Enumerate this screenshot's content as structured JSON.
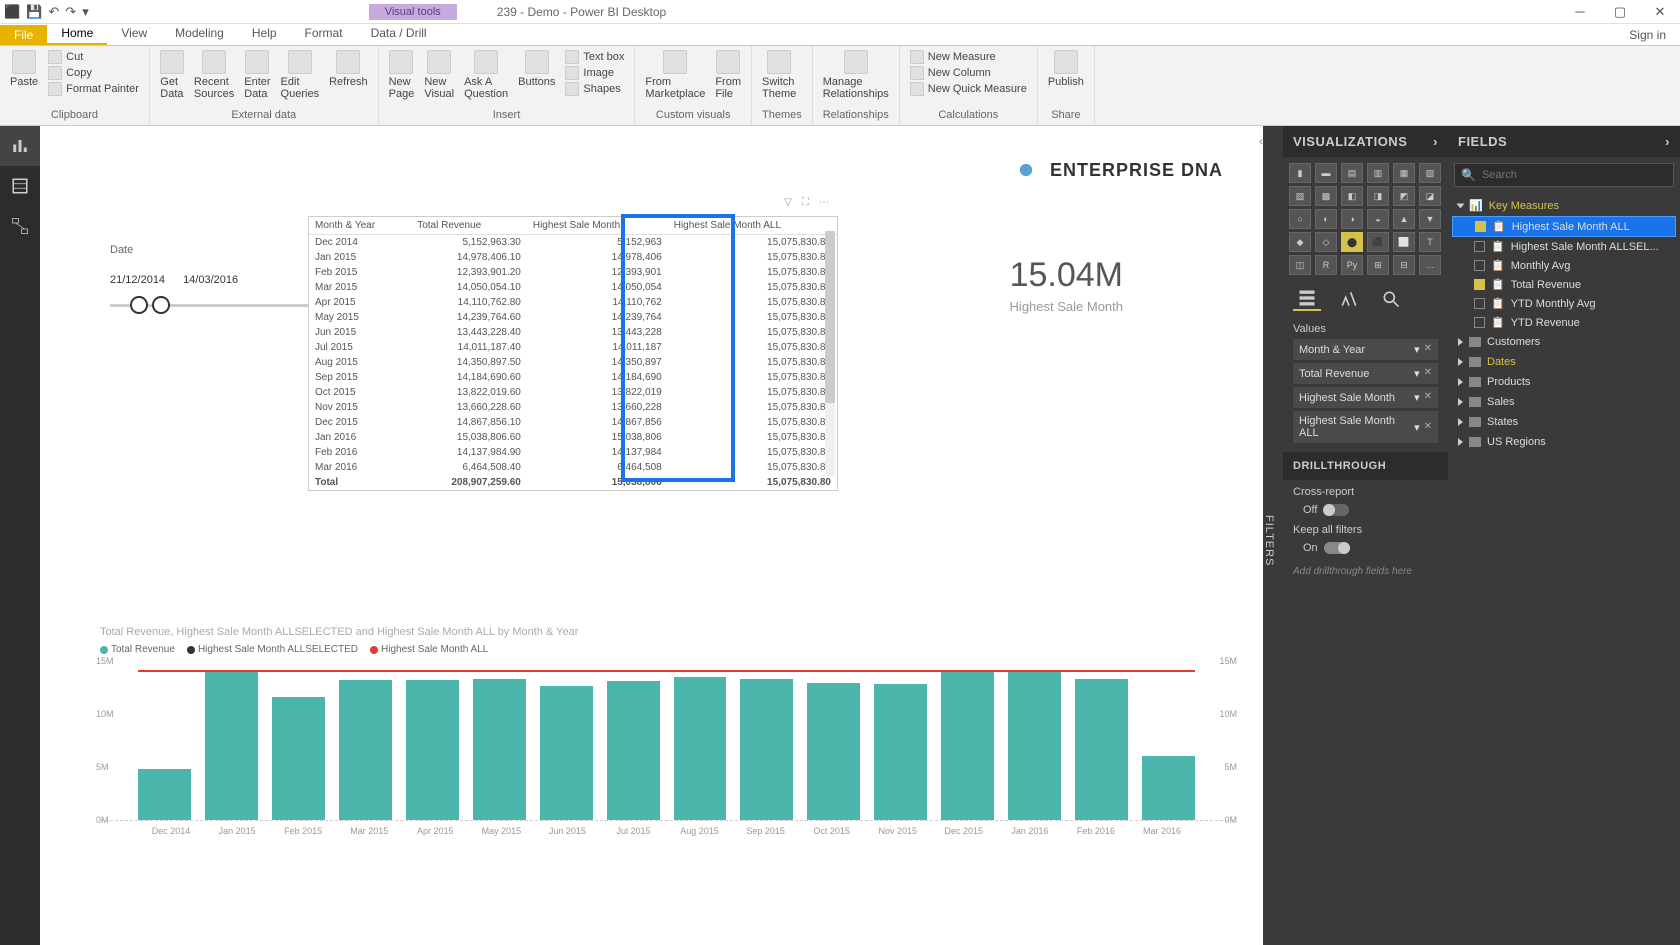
{
  "titlebar": {
    "doc": "239 - Demo - Power BI Desktop",
    "visual_tools": "Visual tools"
  },
  "tabs": {
    "file": "File",
    "items": [
      "Home",
      "View",
      "Modeling",
      "Help",
      "Format",
      "Data / Drill"
    ],
    "active": "Home",
    "signin": "Sign in"
  },
  "ribbon": {
    "clipboard": {
      "paste": "Paste",
      "cut": "Cut",
      "copy": "Copy",
      "fp": "Format Painter",
      "label": "Clipboard"
    },
    "external": {
      "getdata": "Get\nData",
      "recent": "Recent\nSources",
      "enter": "Enter\nData",
      "edit": "Edit\nQueries",
      "refresh": "Refresh",
      "label": "External data"
    },
    "insert": {
      "newpage": "New\nPage",
      "newvisual": "New\nVisual",
      "ask": "Ask A\nQuestion",
      "buttons": "Buttons",
      "textbox": "Text box",
      "image": "Image",
      "shapes": "Shapes",
      "label": "Insert"
    },
    "custom": {
      "market": "From\nMarketplace",
      "file": "From\nFile",
      "label": "Custom visuals"
    },
    "themes": {
      "switch": "Switch\nTheme",
      "label": "Themes"
    },
    "rel": {
      "manage": "Manage\nRelationships",
      "label": "Relationships"
    },
    "calc": {
      "nm": "New Measure",
      "nc": "New Column",
      "nqm": "New Quick Measure",
      "label": "Calculations"
    },
    "share": {
      "publish": "Publish",
      "label": "Share"
    }
  },
  "slicer": {
    "label": "Date",
    "from": "21/12/2014",
    "to": "14/03/2016"
  },
  "table": {
    "headers": [
      "Month & Year",
      "Total Revenue",
      "Highest Sale Month",
      "Highest Sale Month ALL"
    ],
    "rows": [
      [
        "Dec 2014",
        "5,152,963.30",
        "5,152,963",
        "15,075,830.80"
      ],
      [
        "Jan 2015",
        "14,978,406.10",
        "14,978,406",
        "15,075,830.80"
      ],
      [
        "Feb 2015",
        "12,393,901.20",
        "12,393,901",
        "15,075,830.80"
      ],
      [
        "Mar 2015",
        "14,050,054.10",
        "14,050,054",
        "15,075,830.80"
      ],
      [
        "Apr 2015",
        "14,110,762.80",
        "14,110,762",
        "15,075,830.80"
      ],
      [
        "May 2015",
        "14,239,764.60",
        "14,239,764",
        "15,075,830.80"
      ],
      [
        "Jun 2015",
        "13,443,228.40",
        "13,443,228",
        "15,075,830.80"
      ],
      [
        "Jul 2015",
        "14,011,187.40",
        "14,011,187",
        "15,075,830.80"
      ],
      [
        "Aug 2015",
        "14,350,897.50",
        "14,350,897",
        "15,075,830.80"
      ],
      [
        "Sep 2015",
        "14,184,690.60",
        "14,184,690",
        "15,075,830.80"
      ],
      [
        "Oct 2015",
        "13,822,019.60",
        "13,822,019",
        "15,075,830.80"
      ],
      [
        "Nov 2015",
        "13,660,228.60",
        "13,660,228",
        "15,075,830.80"
      ],
      [
        "Dec 2015",
        "14,867,856.10",
        "14,867,856",
        "15,075,830.80"
      ],
      [
        "Jan 2016",
        "15,038,806.60",
        "15,038,806",
        "15,075,830.80"
      ],
      [
        "Feb 2016",
        "14,137,984.90",
        "14,137,984",
        "15,075,830.80"
      ],
      [
        "Mar 2016",
        "6,464,508.40",
        "6,464,508",
        "15,075,830.80"
      ]
    ],
    "total": [
      "Total",
      "208,907,259.60",
      "15,038,806",
      "15,075,830.80"
    ]
  },
  "card": {
    "value": "15.04M",
    "caption": "Highest Sale Month"
  },
  "chart": {
    "title": "Total Revenue, Highest Sale Month ALLSELECTED and Highest Sale Month ALL by Month & Year",
    "legend": [
      "Total Revenue",
      "Highest Sale Month ALLSELECTED",
      "Highest Sale Month ALL"
    ],
    "legend_colors": [
      "#4db6ac",
      "#333",
      "#e53935"
    ],
    "ylabels": [
      "15M",
      "10M",
      "5M",
      "0M"
    ]
  },
  "vizpane": {
    "title": "VISUALIZATIONS",
    "values_label": "Values",
    "wells": [
      "Month & Year",
      "Total Revenue",
      "Highest Sale Month",
      "Highest Sale Month ALL"
    ],
    "drill_label": "DRILLTHROUGH",
    "cross": "Cross-report",
    "cross_state": "Off",
    "keep": "Keep all filters",
    "keep_state": "On",
    "addhint": "Add drillthrough fields here"
  },
  "fieldspane": {
    "title": "FIELDS",
    "search": "Search",
    "key": "Key Measures",
    "measures": [
      {
        "name": "Highest Sale Month",
        "checked": false,
        "hidden": true
      },
      {
        "name": "Highest Sale Month ALL",
        "checked": true,
        "hilite": true
      },
      {
        "name": "Highest Sale Month ALLSEL...",
        "checked": false
      },
      {
        "name": "Monthly Avg",
        "checked": false
      },
      {
        "name": "Total Revenue",
        "checked": true
      },
      {
        "name": "YTD Monthly Avg",
        "checked": false
      },
      {
        "name": "YTD Revenue",
        "checked": false
      }
    ],
    "tables": [
      "Customers",
      "Dates",
      "Products",
      "Sales",
      "States",
      "US Regions"
    ]
  },
  "filters_label": "FILTERS",
  "logo": "ENTERPRISE DNA",
  "chart_data": {
    "type": "bar",
    "title": "Total Revenue, Highest Sale Month ALLSELECTED and Highest Sale Month ALL by Month & Year",
    "categories": [
      "Dec 2014",
      "Jan 2015",
      "Feb 2015",
      "Mar 2015",
      "Apr 2015",
      "May 2015",
      "Jun 2015",
      "Jul 2015",
      "Aug 2015",
      "Sep 2015",
      "Oct 2015",
      "Nov 2015",
      "Dec 2015",
      "Jan 2016",
      "Feb 2016",
      "Mar 2016"
    ],
    "series": [
      {
        "name": "Total Revenue",
        "values": [
          5.15,
          14.98,
          12.39,
          14.05,
          14.11,
          14.24,
          13.44,
          14.01,
          14.35,
          14.18,
          13.82,
          13.66,
          14.87,
          15.04,
          14.14,
          6.46
        ]
      },
      {
        "name": "Highest Sale Month ALLSELECTED",
        "values": [
          15.04,
          15.04,
          15.04,
          15.04,
          15.04,
          15.04,
          15.04,
          15.04,
          15.04,
          15.04,
          15.04,
          15.04,
          15.04,
          15.04,
          15.04,
          15.04
        ]
      },
      {
        "name": "Highest Sale Month ALL",
        "values": [
          15.08,
          15.08,
          15.08,
          15.08,
          15.08,
          15.08,
          15.08,
          15.08,
          15.08,
          15.08,
          15.08,
          15.08,
          15.08,
          15.08,
          15.08,
          15.08
        ]
      }
    ],
    "ylabel": "",
    "xlabel": "",
    "ylim": [
      0,
      16
    ],
    "unit": "M"
  }
}
